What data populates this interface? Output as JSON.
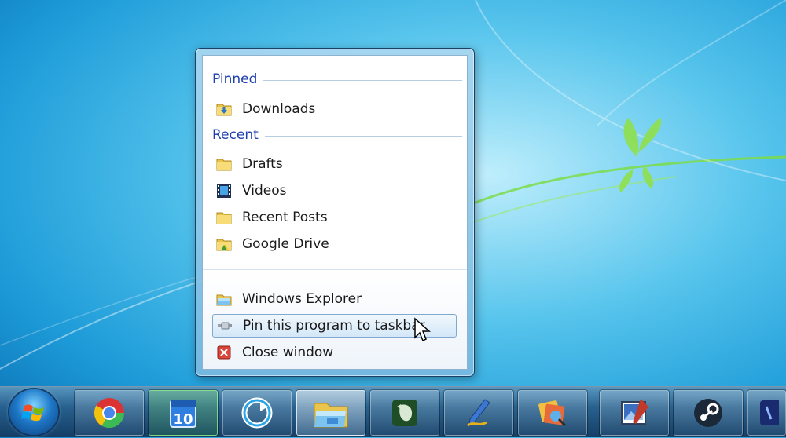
{
  "jumplist": {
    "pinned_header": "Pinned",
    "recent_header": "Recent",
    "pinned": [
      {
        "label": "Downloads",
        "icon": "downloads-folder-icon"
      }
    ],
    "recent": [
      {
        "label": "Drafts",
        "icon": "folder-icon"
      },
      {
        "label": "Videos",
        "icon": "videos-library-icon"
      },
      {
        "label": "Recent Posts",
        "icon": "folder-icon"
      },
      {
        "label": "Google Drive",
        "icon": "google-drive-folder-icon"
      }
    ],
    "tasks": [
      {
        "label": "Windows Explorer",
        "icon": "windows-explorer-icon"
      },
      {
        "label": "Pin this program to taskbar",
        "icon": "pin-icon"
      },
      {
        "label": "Close window",
        "icon": "close-window-icon"
      }
    ]
  },
  "taskbar": {
    "start_icon": "windows-start-orb-icon",
    "apps": [
      {
        "name": "chrome",
        "icon": "chrome-icon"
      },
      {
        "name": "calendar",
        "icon": "calendar-icon",
        "text": "10"
      },
      {
        "name": "refresh-app",
        "icon": "circular-arrow-icon"
      },
      {
        "name": "windows-explorer",
        "icon": "folder-explorer-icon"
      },
      {
        "name": "evernote",
        "icon": "evernote-icon"
      },
      {
        "name": "paint-pen",
        "icon": "pen-icon"
      },
      {
        "name": "photo-app",
        "icon": "photo-gallery-icon"
      },
      {
        "name": "image-editor",
        "icon": "image-editor-icon"
      },
      {
        "name": "steam",
        "icon": "steam-icon"
      },
      {
        "name": "partial-app",
        "icon": "app-icon"
      }
    ]
  },
  "colors": {
    "header_text": "#1e3fae",
    "hover_border": "#7fa9d3",
    "taskbar": "#285f8c"
  }
}
